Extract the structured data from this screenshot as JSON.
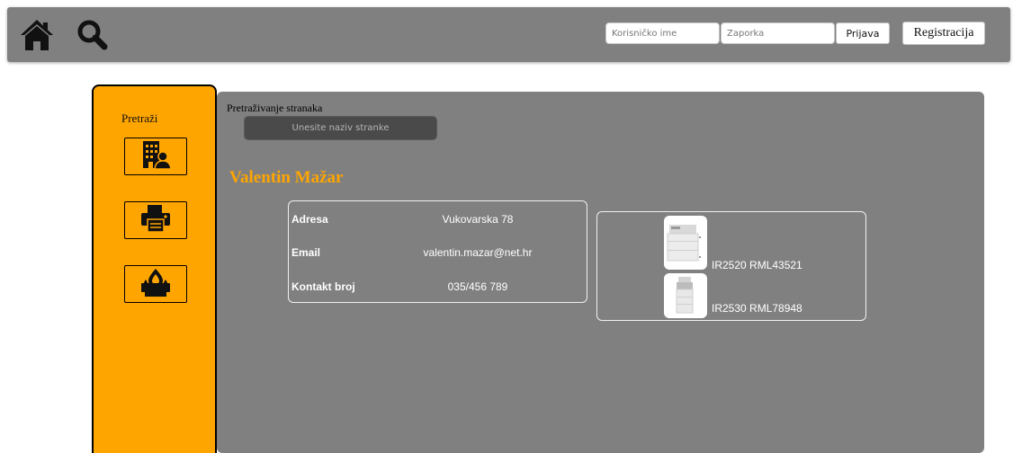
{
  "header": {
    "username_placeholder": "Korisničko ime",
    "password_placeholder": "Zaporka",
    "login_label": "Prijava",
    "register_label": "Registracija"
  },
  "sidebar": {
    "title": "Pretraži",
    "items": [
      {
        "icon": "building-user-icon"
      },
      {
        "icon": "printer-icon"
      },
      {
        "icon": "ink-drop-printer-icon"
      }
    ]
  },
  "main": {
    "search_label": "Pretraživanje stranaka",
    "search_placeholder": "Unesite naziv stranke",
    "client_name": "Valentin Mažar",
    "details": [
      {
        "key": "Adresa",
        "value": "Vukovarska 78"
      },
      {
        "key": "Email",
        "value": "valentin.mazar@net.hr"
      },
      {
        "key": "Kontakt broj",
        "value": "035/456 789"
      }
    ],
    "devices": [
      {
        "label": "IR2520 RML43521"
      },
      {
        "label": "IR2530 RML78948"
      }
    ]
  },
  "colors": {
    "accent": "#ffa500",
    "bar": "#808080",
    "panel": "#808080"
  }
}
